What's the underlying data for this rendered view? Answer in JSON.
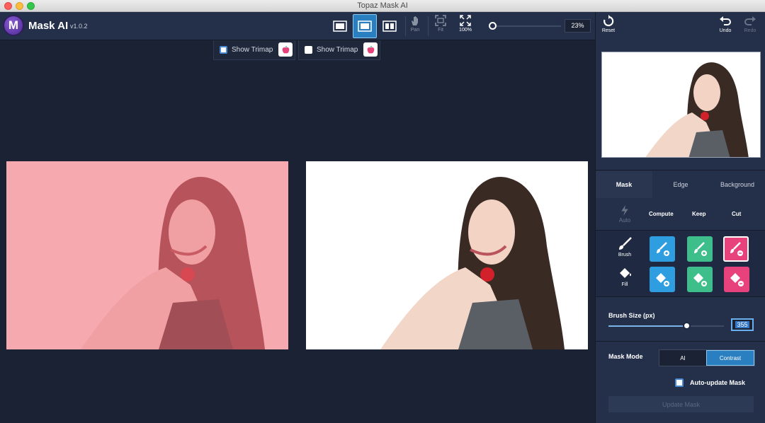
{
  "window": {
    "title": "Topaz Mask AI"
  },
  "app": {
    "name": "Mask AI",
    "version": "v1.0.2",
    "logo_letter": "M"
  },
  "toolbar": {
    "views": [
      {
        "icon": "single-view-icon",
        "active": false
      },
      {
        "icon": "split-view-icon",
        "active": true
      },
      {
        "icon": "side-by-side-view-icon",
        "active": false
      }
    ],
    "pan_label": "Pan",
    "fit_label": "Fit",
    "zoom100_label": "100%",
    "zoom_value": "23%",
    "reset_label": "Reset",
    "undo_label": "Undo",
    "redo_label": "Redo"
  },
  "panels": {
    "left": {
      "trimap_label": "Show Trimap",
      "trimap_checked": true
    },
    "right": {
      "trimap_label": "Show Trimap",
      "trimap_checked": false
    }
  },
  "sidebar": {
    "tabs": [
      {
        "label": "Mask",
        "active": true
      },
      {
        "label": "Edge",
        "active": false
      },
      {
        "label": "Background",
        "active": false
      }
    ],
    "columns": {
      "auto": "Auto",
      "compute": "Compute",
      "keep": "Keep",
      "cut": "Cut"
    },
    "tools": {
      "brush": "Brush",
      "fill": "Fill"
    },
    "brush_size": {
      "label": "Brush Size (px)",
      "value": "355",
      "fraction": 0.67
    },
    "mask_mode": {
      "label": "Mask Mode",
      "options": [
        "AI",
        "Contrast"
      ],
      "selected": "Contrast"
    },
    "auto_update": {
      "label": "Auto-update Mask",
      "checked": true
    },
    "update_button": "Update Mask"
  },
  "colors": {
    "accent": "#2a7fc1",
    "compute_blue": "#2f9ee0",
    "keep_green": "#3dbe8a",
    "cut_pink": "#e8427c",
    "mask_overlay": "#f2a0a6"
  }
}
